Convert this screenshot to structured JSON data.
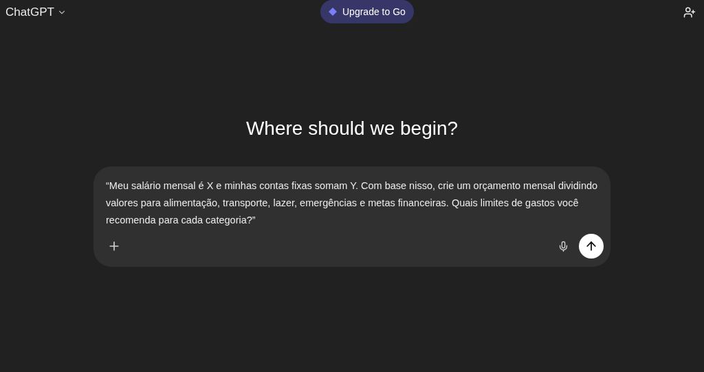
{
  "header": {
    "model": "ChatGPT",
    "upgrade": "Upgrade to Go"
  },
  "heading": "Where should we begin?",
  "composer": {
    "value": " “Meu salário mensal é X e minhas contas fixas somam Y. Com base nisso, crie um orçamento mensal dividindo valores para alimentação, transporte, lazer, emergências e metas financeiras. Quais limites de gastos você recomenda para cada categoria?”"
  }
}
